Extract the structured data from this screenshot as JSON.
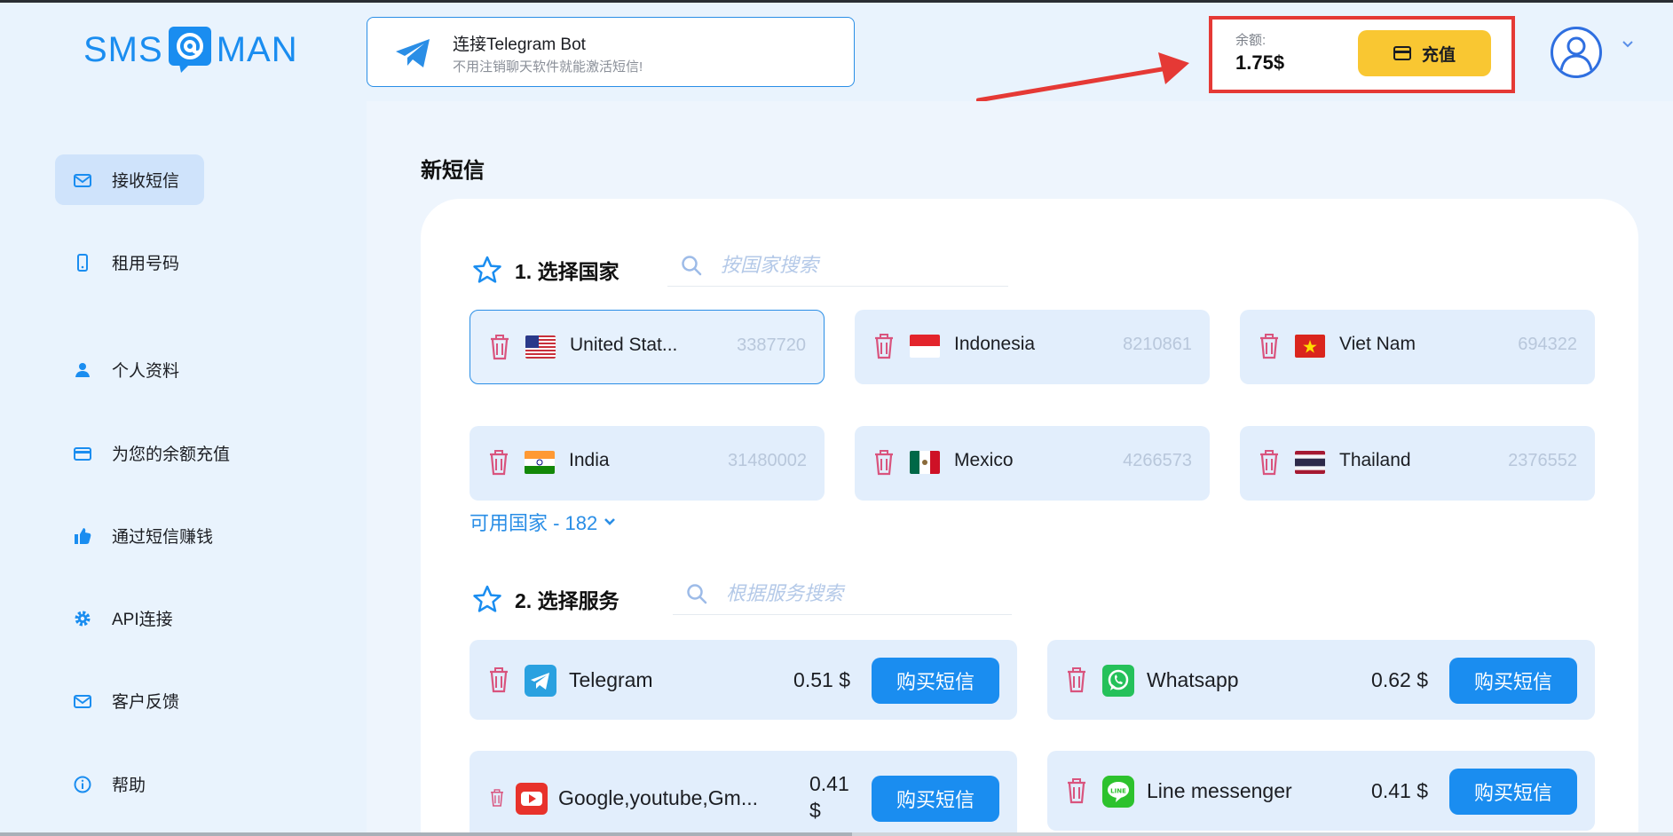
{
  "logo": {
    "left": "SMS",
    "right": "MAN"
  },
  "telegram_banner": {
    "title": "连接Telegram Bot",
    "subtitle": "不用注销聊天软件就能激活短信!"
  },
  "balance": {
    "label": "余额:",
    "amount": "1.75$",
    "topup_label": "充值"
  },
  "sidebar": {
    "items": [
      {
        "label": "接收短信",
        "icon": "envelope-icon",
        "active": true
      },
      {
        "label": "租用号码",
        "icon": "phone-icon",
        "active": false
      },
      {
        "label": "个人资料",
        "icon": "person-icon",
        "active": false
      },
      {
        "label": "为您的余额充值",
        "icon": "card-icon",
        "active": false
      },
      {
        "label": "通过短信赚钱",
        "icon": "thumbs-up-icon",
        "active": false
      },
      {
        "label": "API连接",
        "icon": "gear-icon",
        "active": false
      },
      {
        "label": "客户反馈",
        "icon": "envelope-icon",
        "active": false
      },
      {
        "label": "帮助",
        "icon": "info-icon",
        "active": false
      }
    ]
  },
  "main": {
    "title": "新短信",
    "country_section": {
      "heading": "1. 选择国家",
      "search_placeholder": "按国家搜索",
      "countries": [
        {
          "name": "United Stat...",
          "count": "3387720",
          "flag": "us-flag",
          "selected": true
        },
        {
          "name": "Indonesia",
          "count": "8210861",
          "flag": "id-flag",
          "selected": false
        },
        {
          "name": "Viet Nam",
          "count": "694322",
          "flag": "vn-flag",
          "selected": false
        },
        {
          "name": "India",
          "count": "31480002",
          "flag": "in-flag",
          "selected": false
        },
        {
          "name": "Mexico",
          "count": "4266573",
          "flag": "mx-flag",
          "selected": false
        },
        {
          "name": "Thailand",
          "count": "2376552",
          "flag": "th-flag",
          "selected": false
        }
      ],
      "available_label": "可用国家 - 182"
    },
    "service_section": {
      "heading": "2. 选择服务",
      "search_placeholder": "根据服务搜索",
      "services": [
        {
          "name": "Telegram",
          "price": "0.51 $",
          "icon": "telegram-icon",
          "buy_label": "购买短信"
        },
        {
          "name": "Whatsapp",
          "price": "0.62 $",
          "icon": "whatsapp-icon",
          "buy_label": "购买短信"
        },
        {
          "name": "Google,youtube,Gm...",
          "price_line1": "0.41",
          "price_line2": "$",
          "icon": "youtube-icon",
          "buy_label": "购买短信"
        },
        {
          "name": "Line messenger",
          "price": "0.41 $",
          "icon": "line-icon",
          "buy_label": "购买短信"
        }
      ]
    }
  },
  "colors": {
    "accent": "#1a8df0",
    "topup": "#f9c732",
    "highlight": "#e53935",
    "card_bg": "#e2eefc",
    "trash": "#d9547e"
  }
}
